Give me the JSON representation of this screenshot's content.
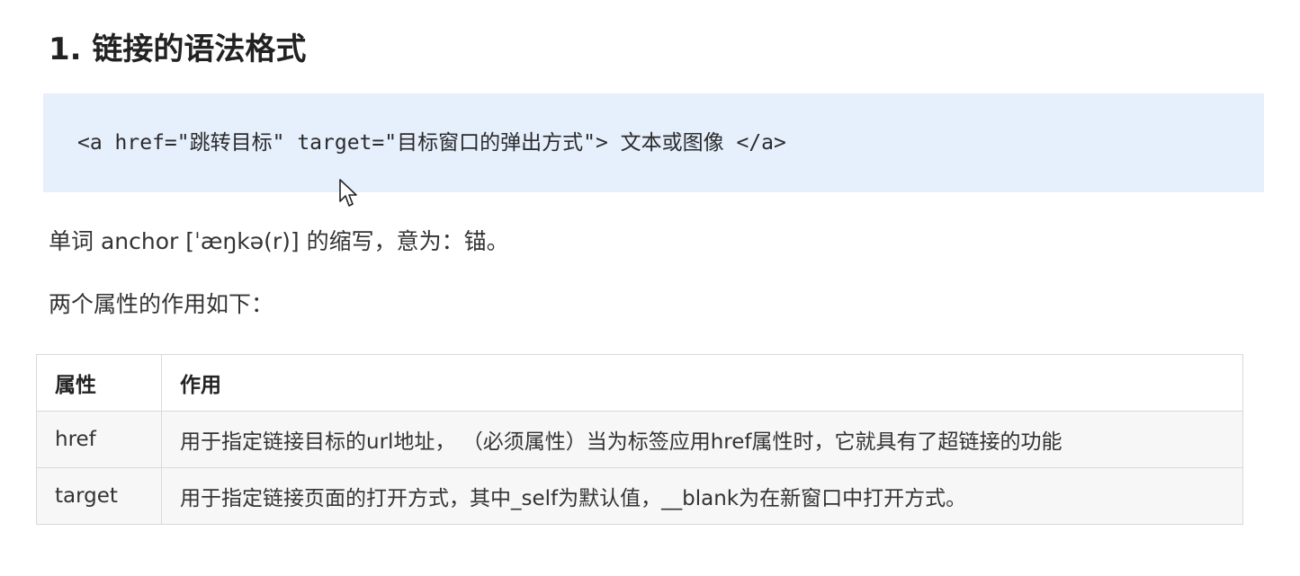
{
  "heading": "1. 链接的语法格式",
  "code": "<a href=\"跳转目标\" target=\"目标窗口的弹出方式\"> 文本或图像 </a>",
  "paragraphs": {
    "anchor_note": "单词 anchor [ˈæŋkə(r)] 的缩写，意为：锚。",
    "attrs_intro": "两个属性的作用如下："
  },
  "table": {
    "headers": [
      "属性",
      "作用"
    ],
    "rows": [
      [
        "href",
        "用于指定链接目标的url地址， （必须属性）当为标签应用href属性时，它就具有了超链接的功能"
      ],
      [
        "target",
        "用于指定链接页面的打开方式，其中_self为默认值，__blank为在新窗口中打开方式。"
      ]
    ]
  },
  "colors": {
    "code_background": "#e6effc",
    "table_border": "#d9d9d9",
    "row_alt_background": "#f7f7f7"
  },
  "icons": {
    "cursor": "mouse-pointer-icon"
  }
}
